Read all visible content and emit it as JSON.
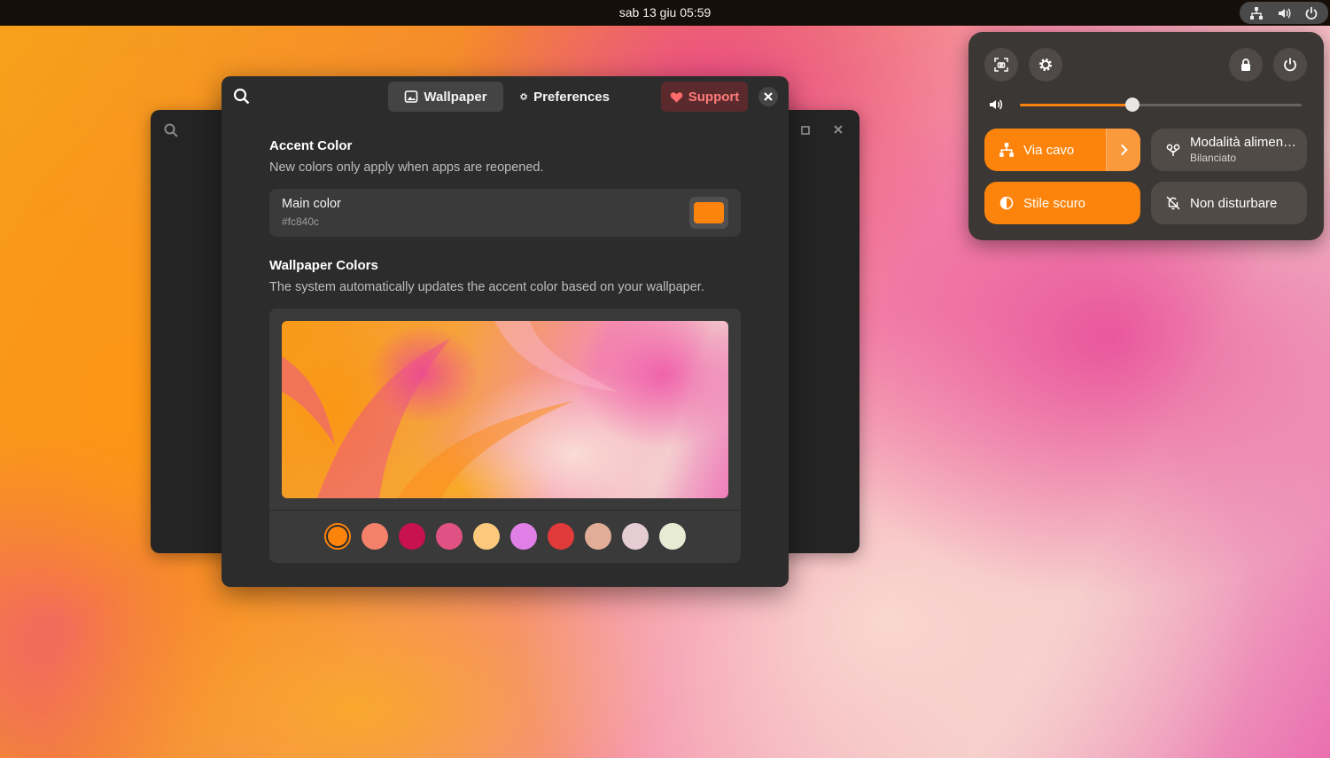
{
  "topbar": {
    "clock": "sab 13 giu  05:59",
    "tray_icons": [
      "network-wired-icon",
      "volume-icon",
      "power-icon"
    ]
  },
  "dialog": {
    "tabs": [
      {
        "label": "Wallpaper",
        "icon": "image-icon",
        "active": true
      },
      {
        "label": "Preferences",
        "icon": "gear-icon",
        "active": false
      }
    ],
    "support_label": "Support",
    "accent": {
      "title": "Accent Color",
      "subtitle": "New colors only apply when apps are reopened.",
      "main_label": "Main color",
      "main_value": "#fc840c",
      "main_color": "#fc840c"
    },
    "wallpaper_colors": {
      "title": "Wallpaper Colors",
      "subtitle": "The system automatically updates the accent color based on your wallpaper.",
      "swatches": [
        "#fc840c",
        "#f4826a",
        "#c8114f",
        "#e15284",
        "#fcc87c",
        "#e07fe6",
        "#e03a3a",
        "#e2ad96",
        "#e6cdd4",
        "#e8ebd3"
      ],
      "selected_index": 0
    }
  },
  "quick_settings": {
    "volume_level": 0.4,
    "tiles": {
      "wired": {
        "label": "Via cavo",
        "active": true
      },
      "power_mode": {
        "label": "Modalità alimen…",
        "sublabel": "Bilanciato",
        "active": false
      },
      "dark_style": {
        "label": "Stile scuro",
        "active": true
      },
      "dnd": {
        "label": "Non disturbare",
        "active": false
      }
    }
  },
  "colors": {
    "accent": "#fc840c",
    "support_text": "#ff7b7b"
  }
}
